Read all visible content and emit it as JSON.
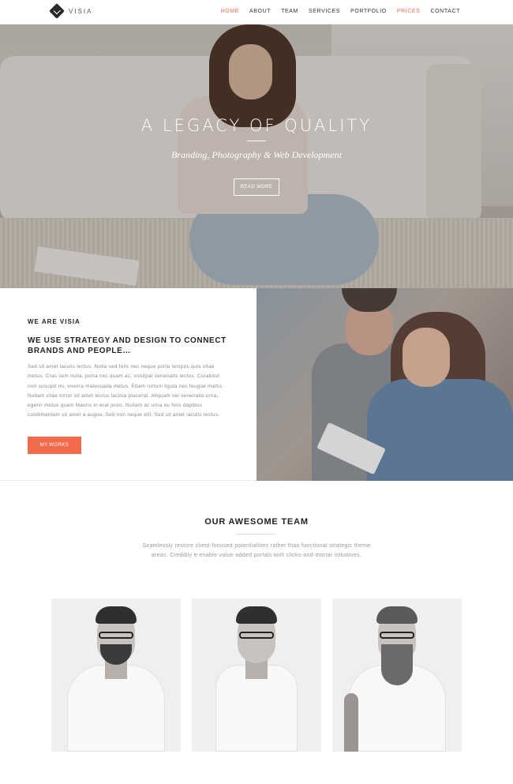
{
  "nav": {
    "logo_text": "VISIA",
    "items": [
      {
        "label": "HOME",
        "active": true
      },
      {
        "label": "ABOUT",
        "active": false
      },
      {
        "label": "TEAM",
        "active": false
      },
      {
        "label": "SERVICES",
        "active": false
      },
      {
        "label": "PORTFOLIO",
        "active": false
      },
      {
        "label": "PRICES",
        "active": true
      },
      {
        "label": "CONTACT",
        "active": false
      }
    ]
  },
  "hero": {
    "title": "A LEGACY OF QUALITY",
    "subtitle": "Branding, Photography & Web Development",
    "button_label": "READ MORE"
  },
  "about": {
    "eyebrow": "WE ARE VISIA",
    "title": "WE USE STRATEGY AND DESIGN TO CONNECT BRANDS AND PEOPLE…",
    "text": "Sed sit amet iaculis lectus. Nulla sed felis nec neque porta tempus quis vitae metus. Cras sem nulla, porta nec quam ac, volutpat venenatis lectus. Curabitur non suscipit mi, viverra malesuada metus. Etiam rutrum ligula nec feugiat mattis. Nullam vitae tortor sit amet lectus lacinia placerat. Aliquam vel venenatis urna, egetin metus quam Mauris in erat justo. Nullam ac urna eu felis dapibus condimentum sit amet a augue. Sed non neque elit. Sed sit amet iaculis lectus.",
    "button_label": "MY WORKS"
  },
  "team": {
    "title": "OUR AWESOME TEAM",
    "text": "Seamlessly restore client-focused potentialities rather than functional strategic theme areas. Credibly e-enable value-added portals with clicks-and-mortar initiatives."
  },
  "colors": {
    "accent": "#f36a4c",
    "text_dark": "#222222",
    "text_muted": "#888888"
  }
}
